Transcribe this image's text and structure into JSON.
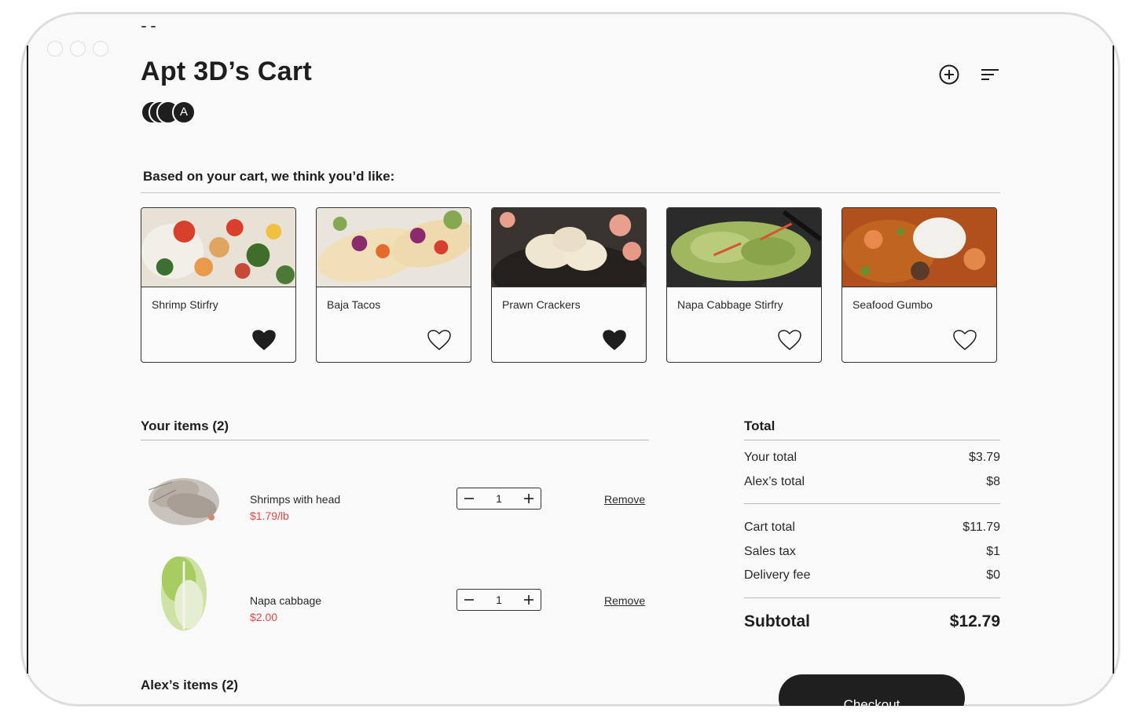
{
  "page": {
    "title": "Apt 3D’s Cart"
  },
  "avatars": {
    "last_initial": "A"
  },
  "icons": {
    "add": "plus-circle-icon",
    "filter": "filter-lines-icon",
    "heart_filled": "heart-filled-icon",
    "heart_outline": "heart-outline-icon"
  },
  "recommendations": {
    "heading": "Based on your cart, we think you’d like:",
    "cards": [
      {
        "name": "Shrimp Stirfry",
        "liked": true
      },
      {
        "name": "Baja Tacos",
        "liked": false
      },
      {
        "name": "Prawn Crackers",
        "liked": true
      },
      {
        "name": "Napa Cabbage Stirfry",
        "liked": false
      },
      {
        "name": "Seafood Gumbo",
        "liked": false
      }
    ]
  },
  "your_items": {
    "title": "Your items (2)",
    "items": [
      {
        "name": "Shrimps with head",
        "price": "$1.79/lb",
        "qty": "1",
        "remove_label": "Remove"
      },
      {
        "name": "Napa cabbage",
        "price": "$2.00",
        "qty": "1",
        "remove_label": "Remove"
      }
    ]
  },
  "alex_items": {
    "title": "Alex’s items (2)"
  },
  "totals": {
    "title": "Total",
    "your_total": {
      "label": "Your total",
      "value": "$3.79"
    },
    "alex_total": {
      "label": "Alex’s total",
      "value": "$8"
    },
    "cart_total": {
      "label": "Cart total",
      "value": "$11.79"
    },
    "sales_tax": {
      "label": "Sales tax",
      "value": "$1"
    },
    "delivery_fee": {
      "label": "Delivery fee",
      "value": "$0"
    },
    "subtotal": {
      "label": "Subtotal",
      "value": "$12.79"
    }
  },
  "checkout": {
    "label": "Checkout"
  },
  "colors": {
    "accent": "#1e1e1e",
    "price": "#e04848",
    "background": "#f9f9f9"
  }
}
